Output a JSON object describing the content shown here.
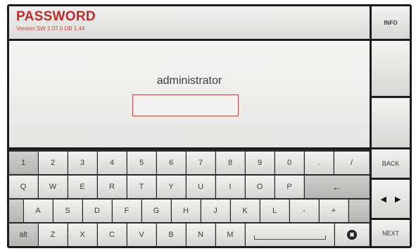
{
  "header": {
    "title": "PASSWORD",
    "version": "Version SW 2.07.0 DB 1.44"
  },
  "right_panel": {
    "info_label": "INFO",
    "back_label": "BACK",
    "next_label": "NEXT",
    "arrow_left": "◀",
    "arrow_right": "▶"
  },
  "main": {
    "user_label": "administrator",
    "password_value": ""
  },
  "keyboard": {
    "row1": [
      "1",
      "2",
      "3",
      "4",
      "5",
      "6",
      "7",
      "8",
      "9",
      "0",
      ".",
      "/"
    ],
    "row2": [
      "Q",
      "W",
      "E",
      "R",
      "T",
      "Y",
      "U",
      "I",
      "O",
      "P",
      "←"
    ],
    "row3": [
      "A",
      "S",
      "D",
      "F",
      "G",
      "H",
      "J",
      "K",
      "L",
      "-",
      "+"
    ],
    "row4": [
      "alt",
      "Z",
      "X",
      "C",
      "V",
      "B",
      "N",
      "M"
    ],
    "clear_glyph": "✖"
  },
  "colors": {
    "title": "#c32a2a",
    "field_border": "#c94a4a"
  }
}
